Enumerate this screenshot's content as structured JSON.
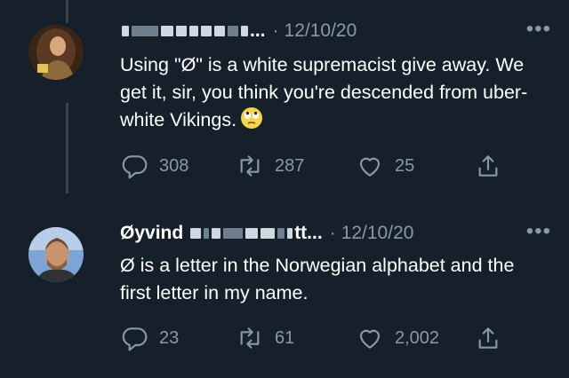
{
  "tweets": [
    {
      "name": "",
      "handle_suffix": "...",
      "separator": "·",
      "date": "12/10/20",
      "more": "•••",
      "text": "Using \"Ø\" is a white supremacist give away.  We get it, sir, you think you're descended from uber-white Vikings.",
      "emoji": "eye-roll-emoji",
      "actions": {
        "replies": "308",
        "retweets": "287",
        "likes": "25"
      }
    },
    {
      "name": "Øyvind",
      "handle_suffix": "tt...",
      "separator": "·",
      "date": "12/10/20",
      "more": "•••",
      "text": "Ø is a letter in the Norwegian alphabet and the first letter in my name.",
      "actions": {
        "replies": "23",
        "retweets": "61",
        "likes": "2,002"
      }
    }
  ],
  "colors": {
    "background": "#15202b",
    "text": "#ffffff",
    "muted": "#8b98a5",
    "thread_line": "#38444d"
  }
}
